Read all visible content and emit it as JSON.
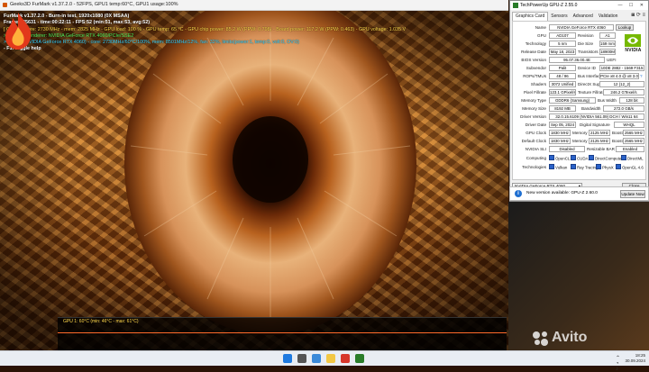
{
  "furmark": {
    "title": "Geeks3D FurMark v1.37.2.0 - 52FPS, GPU1 temp:60°C, GPU1 usage:100%",
    "osd": [
      {
        "text": "FurMark v1.37.2.0 - Burn-in test, 1920x1080 (0X MSAA)",
        "color": "w"
      },
      {
        "text": "Frames:85631 - time:00:22:11 - FPS:52 (min:51, max:53, avg:52)",
        "color": "w"
      },
      {
        "text": "[ GPU-Z ] core: 2730 MHz - mem: 2825 MHz - GPU load: 100 % - GPU temp: 65 °C - GPU chip power: 85.2 W (PPW: 0.798) - Board power: 117.2 W (PPW: 0.463) - GPU voltage: 1.035 V",
        "color": "y"
      },
      {
        "text": "> OpenGL renderer: NVIDIA GeForce RTX 4060/PCIe/SSE2",
        "color": "g"
      },
      {
        "text": "> GPU 1 (NVIDIA GeForce RTX 4060) - core: 2730MHz/60°C/100%, mem: 8501MHz/12%, fan: 32%, limits(power:1, temp:0, volt:0, OV:0)",
        "color": "c"
      },
      {
        "text": "- F1: toggle help",
        "color": "w"
      }
    ],
    "graph_label": "GPU 1: 60°C (min: 46°C - max: 61°C)"
  },
  "gpuz": {
    "title": "TechPowerUp GPU-Z 2.55.0",
    "tabs": [
      "Graphics Card",
      "Sensors",
      "Advanced",
      "Validation"
    ],
    "name": {
      "label": "Name",
      "value": "NVIDIA GeForce RTX 4060",
      "button": "Lookup"
    },
    "gpu": {
      "label": "GPU",
      "value": "AD107",
      "sub_label": "Revision",
      "sub_value": "A1"
    },
    "technology": {
      "label": "Technology",
      "value": "5 nm",
      "sub_label": "Die Size",
      "sub_value": "159 mm²"
    },
    "release": {
      "label": "Release Date",
      "value": "May 18, 2023",
      "sub_label": "Transistors",
      "sub_value": "18900M"
    },
    "bios": {
      "label": "BIOS Version",
      "value": "95.07.36.00.4E",
      "uefi": "UEFI"
    },
    "subvendor": {
      "label": "Subvendor",
      "value": "Palit",
      "sub_label": "Device ID",
      "sub_value": "10DE 2882 - 1569 F315"
    },
    "rops": {
      "label": "ROPs/TMUs",
      "value": "48 / 96",
      "sub_label": "Bus Interface",
      "sub_value": "PCIe x8 4.0 @ x8 3.0"
    },
    "shaders": {
      "label": "Shaders",
      "value": "3072 Unified",
      "sub_label": "DirectX Support",
      "sub_value": "12 (12_2)"
    },
    "pixel": {
      "label": "Pixel Fillrate",
      "value": "123.1 GPixel/s",
      "sub_label": "Texture Fillrate",
      "sub_value": "246.2 GTexel/s"
    },
    "memtype": {
      "label": "Memory Type",
      "value": "GDDR6 (Samsung)",
      "sub_label": "Bus Width",
      "sub_value": "128 bit"
    },
    "memsize": {
      "label": "Memory Size",
      "value": "8192 MB",
      "sub_label": "Bandwidth",
      "sub_value": "272.0 GB/s"
    },
    "driver": {
      "label": "Driver Version",
      "value": "32.0.15.6109 (NVIDIA 561.09) DCH / Win11 64"
    },
    "driver_date": {
      "label": "Driver Date",
      "value": "Sep 05, 2024",
      "sub_label": "Digital Signature",
      "sub_value": "WHQL"
    },
    "gpu_clock": {
      "label": "GPU Clock",
      "value": "1830 MHz",
      "mem_label": "Memory",
      "mem_value": "2125 MHz",
      "boost_label": "Boost",
      "boost_value": "2565 MHz"
    },
    "default_clock": {
      "label": "Default Clock",
      "value": "1830 MHz",
      "mem_label": "Memory",
      "mem_value": "2125 MHz",
      "boost_label": "Boost",
      "boost_value": "2565 MHz"
    },
    "sli": {
      "label": "NVIDIA SLI",
      "value": "Disabled",
      "sub_label": "Resizable BAR",
      "sub_value": "Enabled"
    },
    "computing": {
      "label": "Computing",
      "items": [
        "OpenCL",
        "CUDA",
        "DirectCompute",
        "DirectML"
      ]
    },
    "technologies": {
      "label": "Technologies",
      "items": [
        "Vulkan",
        "Ray Tracing",
        "PhysX",
        "OpenGL 4.6"
      ]
    },
    "device_select": "NVIDIA GeForce RTX 4060",
    "close_button": "Close",
    "vendor_word": "NVIDIA"
  },
  "update": {
    "message": "New version available: GPU-Z 2.60.0",
    "button": "Update Now"
  },
  "watermark": "Avito",
  "taskbar": {
    "time": "18:25",
    "date": "30.09.2024",
    "lang": "РУС"
  },
  "colors": {
    "nvidia_green": "#76b900",
    "fur_light": "#e8b27a",
    "fur_dark": "#5a2608",
    "osd_yellow": "#ffd84a",
    "osd_green": "#54f05a",
    "osd_cyan": "#3fd7ff"
  }
}
